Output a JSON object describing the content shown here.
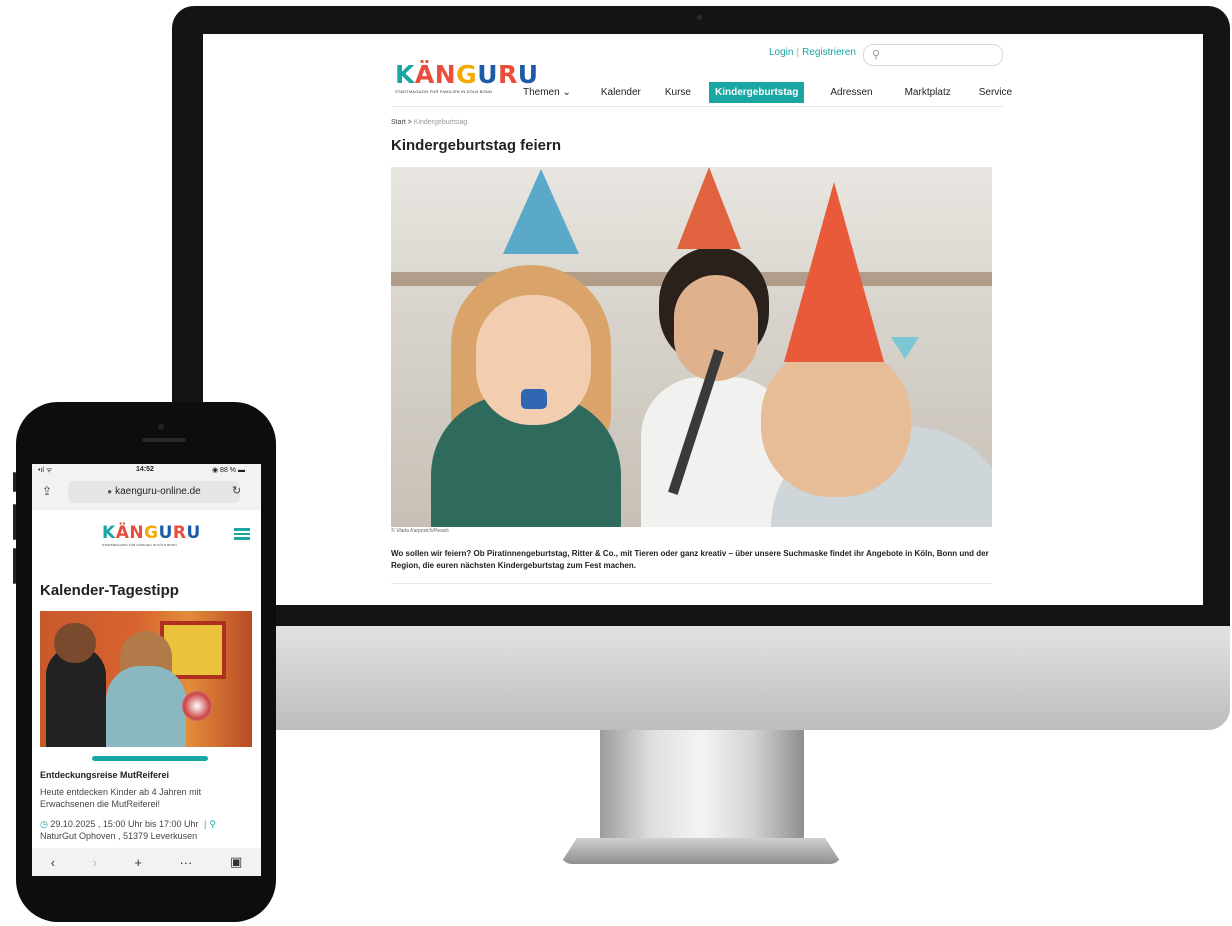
{
  "desktop": {
    "header": {
      "login_label": "Login",
      "separator": "|",
      "register_label": "Registrieren",
      "search_icon": "search-icon"
    },
    "logo": {
      "letters": [
        "K",
        "Ä",
        "N",
        "G",
        "U",
        "R",
        "U"
      ],
      "letter_colors": [
        "#1aa6a3",
        "#e94e3c",
        "#e94e3c",
        "#f2a900",
        "#1d5aa8",
        "#e94e3c",
        "#1d5aa8"
      ],
      "tagline": "STADTMAGAZIN FÜR FAMILIEN IN KÖLN BONN"
    },
    "nav": {
      "items": [
        "Themen ⌄",
        "Kalender",
        "Kurse",
        "Kindergeburtstag",
        "Adressen",
        "Marktplatz",
        "Service"
      ],
      "active_index": 3,
      "accent_color": "#1aa6a3"
    },
    "breadcrumb": {
      "home": "Start",
      "separator": ">",
      "current": "Kindergeburtstag"
    },
    "page_title": "Kindergeburtstag feiern",
    "hero_credit": "© Vlada Karpovich/Pexels",
    "intro_text": "Wo sollen wir feiern? Ob Piratinnengeburtstag, Ritter & Co., mit Tieren oder ganz kreativ – über unsere Suchmaske findet ihr Angebote in Köln, Bonn und der Region, die euren nächsten Kindergeburtstag zum Fest machen."
  },
  "mobile": {
    "status": {
      "signal": "•ıl ᯤ",
      "time": "14:52",
      "battery": "◉ 88 % ▬"
    },
    "browser": {
      "share_icon": "share-icon",
      "lock_icon": "lock-icon",
      "url": "kaenguru-online.de",
      "reload_icon": "reload-icon"
    },
    "menu_icon": "hamburger-menu-icon",
    "section_title": "Kalender-Tagestipp",
    "event": {
      "title": "Entdeckungsreise MutReiferei",
      "description": "Heute entdecken Kinder ab 4 Jahren mit Erwachsenen die MutReiferei!",
      "date_time": "29.10.2025 , 15:00 Uhr bis 17:00 Uhr",
      "location": "NaturGut Ophoven , 51379 Leverkusen",
      "clock_icon": "clock-icon",
      "pin_icon": "map-pin-icon"
    },
    "toolbar": {
      "back": "‹",
      "forward": "›",
      "new_tab": "+",
      "more": "···",
      "tabs": "▣"
    }
  }
}
